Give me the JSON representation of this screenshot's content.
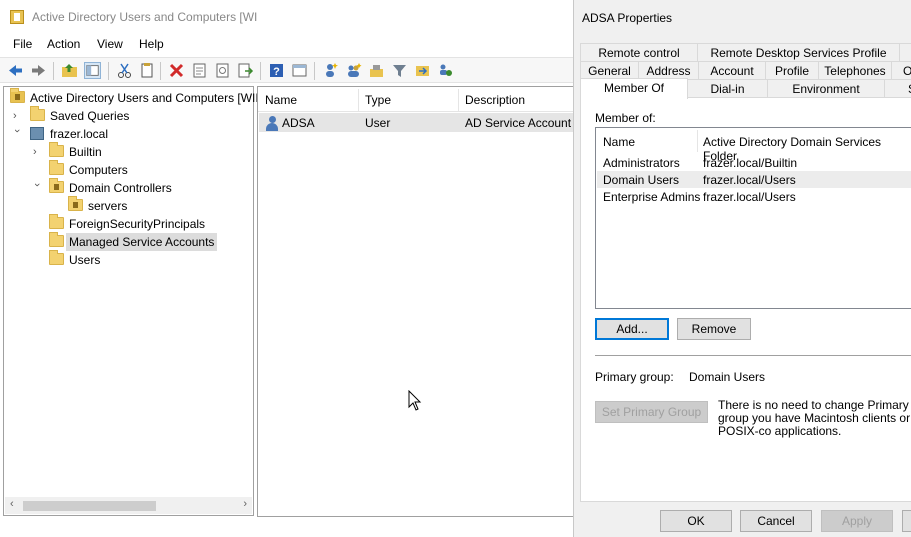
{
  "main_window": {
    "title": "Active Directory Users and Computers [WI",
    "menu": [
      "File",
      "Action",
      "View",
      "Help"
    ]
  },
  "tree": {
    "root": "Active Directory Users and Computers [WII",
    "items": [
      {
        "label": "Saved Queries",
        "indent": 0
      },
      {
        "label": "frazer.local",
        "indent": 0
      },
      {
        "label": "Builtin",
        "indent": 1
      },
      {
        "label": "Computers",
        "indent": 1
      },
      {
        "label": "Domain Controllers",
        "indent": 1
      },
      {
        "label": "servers",
        "indent": 2
      },
      {
        "label": "ForeignSecurityPrincipals",
        "indent": 1
      },
      {
        "label": "Managed Service Accounts",
        "indent": 1
      },
      {
        "label": "Users",
        "indent": 1
      }
    ]
  },
  "list": {
    "columns": [
      "Name",
      "Type",
      "Description"
    ],
    "rows": [
      {
        "name": "ADSA",
        "type": "User",
        "description": "AD Service Account"
      }
    ]
  },
  "dialog": {
    "title": "ADSA Properties",
    "tabs_row1": [
      "Remote control",
      "Remote Desktop Services Profile",
      ""
    ],
    "tabs_row2": [
      "General",
      "Address",
      "Account",
      "Profile",
      "Telephones",
      "O"
    ],
    "tabs_row3": [
      "Member Of",
      "Dial-in",
      "Environment",
      "S"
    ],
    "member_of_label": "Member of:",
    "columns": [
      "Name",
      "Active Directory Domain Services Folder"
    ],
    "groups": [
      {
        "name": "Administrators",
        "folder": "frazer.local/Builtin"
      },
      {
        "name": "Domain Users",
        "folder": "frazer.local/Users"
      },
      {
        "name": "Enterprise Admins",
        "folder": "frazer.local/Users"
      }
    ],
    "add_button": "Add...",
    "remove_button": "Remove",
    "primary_group_label": "Primary group:",
    "primary_group_value": "Domain Users",
    "set_primary_button": "Set Primary Group",
    "note": "There is no need to change Primary group you have Macintosh clients or POSIX-co applications.",
    "ok_button": "OK",
    "cancel_button": "Cancel",
    "apply_button": "Apply"
  }
}
